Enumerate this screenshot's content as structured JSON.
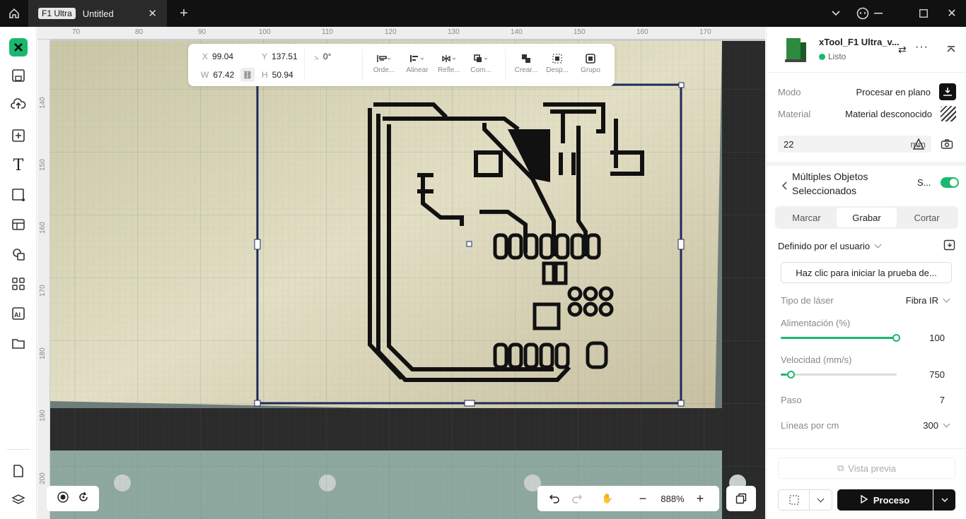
{
  "tab": {
    "badge": "F1 Ultra",
    "title": "Untitled"
  },
  "ruler": {
    "top": [
      "70",
      "80",
      "90",
      "100",
      "110",
      "120",
      "130",
      "140",
      "150",
      "160",
      "170"
    ],
    "left": [
      "140",
      "150",
      "160",
      "170",
      "180",
      "190",
      "200"
    ]
  },
  "toolbar": {
    "x_label": "X",
    "x_value": "99.04",
    "y_label": "Y",
    "y_value": "137.51",
    "w_label": "W",
    "w_value": "67.42",
    "h_label": "H",
    "h_value": "50.94",
    "rotation": "0°",
    "tools": [
      "Orde...",
      "Alinear",
      "Refle...",
      "Com...",
      "Crear...",
      "Desp...",
      "Grupo"
    ]
  },
  "zoom": "888%",
  "device": {
    "name": "xTool_F1 Ultra_v...",
    "status": "Listo"
  },
  "settings": {
    "mode_label": "Modo",
    "mode_value": "Procesar en plano",
    "material_label": "Material",
    "material_value": "Material desconocido",
    "thickness": "22",
    "thickness_unit": "mm"
  },
  "selection": {
    "title": "Múltiples Objetos Seleccionados",
    "toggle_label": "S...",
    "tabs": [
      "Marcar",
      "Grabar",
      "Cortar"
    ],
    "preset": "Definido por el usuario",
    "test_button": "Haz clic para iniciar la prueba de...",
    "laser_label": "Tipo de láser",
    "laser_value": "Fibra IR",
    "power_label": "Alimentación (%)",
    "power_value": "100",
    "speed_label": "Velocidad (mm/s)",
    "speed_value": "750",
    "pass_label": "Paso",
    "pass_value": "7",
    "lines_label": "Líneas por cm",
    "lines_value": "300"
  },
  "footer": {
    "preview": "Vista previa",
    "process": "Proceso"
  },
  "colors": {
    "accent": "#19b86e",
    "dark": "#111111"
  }
}
